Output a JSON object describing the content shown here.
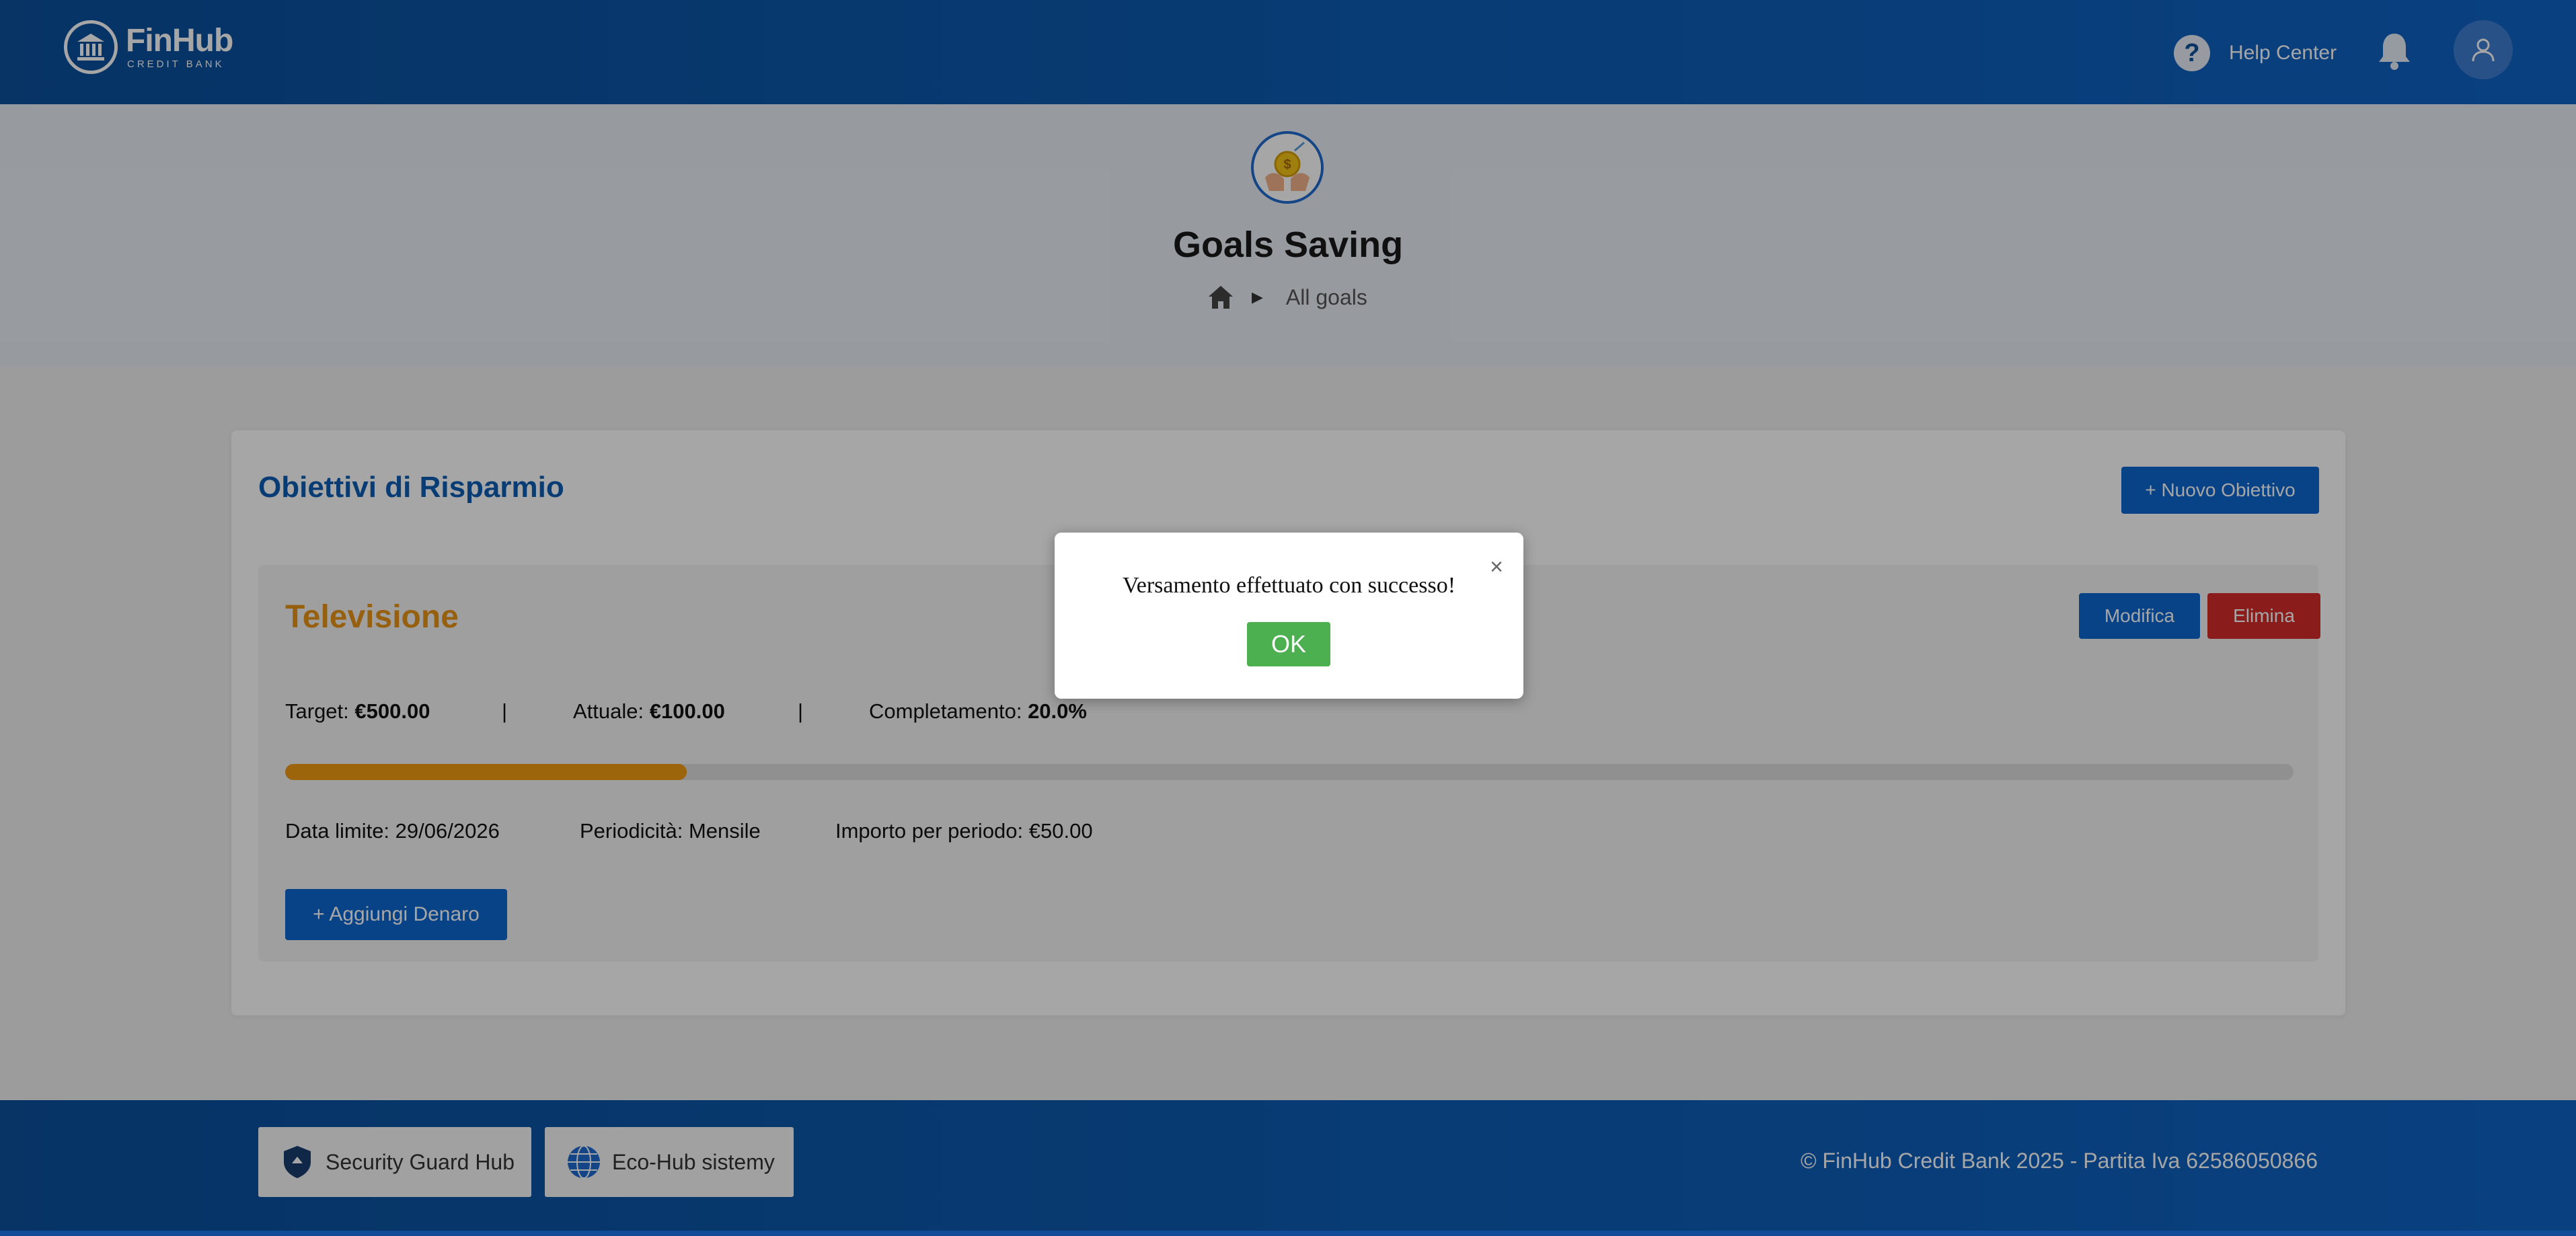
{
  "header": {
    "brand_name": "FinHub",
    "brand_sub": "CREDIT BANK",
    "help_label": "Help Center"
  },
  "hero": {
    "title": "Goals Saving",
    "breadcrumb_current": "All goals"
  },
  "card": {
    "title": "Obiettivi di Risparmio",
    "new_goal_label": "+ Nuovo Obiettivo",
    "goal": {
      "name": "Televisione",
      "edit_label": "Modifica",
      "delete_label": "Elimina",
      "target_label": "Target: ",
      "target_value": "€500.00",
      "separator": "|",
      "current_label": "Attuale: ",
      "current_value": "€100.00",
      "completion_label": "Completamento: ",
      "completion_value": "20.0%",
      "progress_fraction": 0.2,
      "deadline": "Data limite: 29/06/2026",
      "frequency": "Periodicità: Mensile",
      "amount_per_period": "Importo per periodo: €50.00",
      "add_money_label": "+ Aggiungi Denaro"
    }
  },
  "footer": {
    "partner_1": "Security Guard Hub",
    "partner_2": "Eco-Hub sistemy",
    "copyright": "© FinHub Credit Bank 2025 - Partita Iva 62586050866"
  },
  "modal": {
    "message": "Versamento effettuato con successo!",
    "ok_label": "OK",
    "close_symbol": "×"
  },
  "colors": {
    "primary": "#0d66d0",
    "accent_orange": "#e79418",
    "danger": "#d42c2c",
    "success": "#4caf50"
  }
}
